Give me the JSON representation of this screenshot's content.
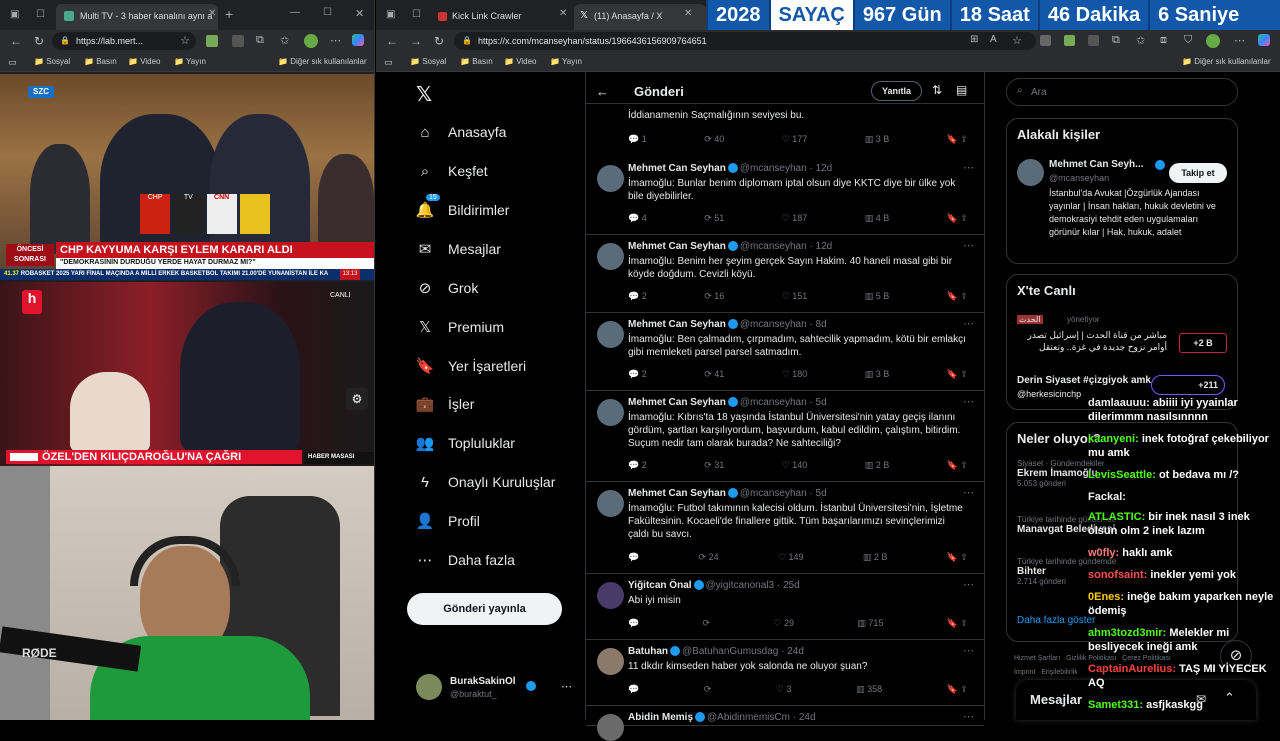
{
  "left_browser": {
    "tab_title": "Multi TV - 3 haber kanalını aynı a",
    "url": "https://lab.mert...",
    "bookmarks": [
      "Sosyal",
      "Basın",
      "Video",
      "Yayın",
      "Diğer sık kullanılanlar"
    ],
    "tv1": {
      "channel": "SZC",
      "corner_label": "ÖNCESİ SONRASI",
      "headline": "CHP KAYYUMA KARŞI EYLEM KARARI ALDI",
      "subline": "\"DEMOKRASİNİN DURDUĞU YERDE HAYAT DURMAZ MI?\"",
      "ticker": "ROBASKET 2025 YARI FİNAL MAÇINDA A MİLLİ ERKEK BASKETBOL TAKIMI 21.00'DE YUNANİSTAN İLE KA",
      "time": "13:13",
      "temp": "41.37",
      "mic_labels": [
        "CNN",
        "CHP",
        "TV"
      ]
    },
    "tv2": {
      "channel": "h",
      "live_label": "CANLI",
      "headline": "ÖZEL'DEN KILIÇDAROĞLU'NA ÇAĞRI",
      "sub_label": "HABER MASASI"
    },
    "cam": {
      "mic_brand": "RØDE"
    }
  },
  "right_browser": {
    "tabs": [
      {
        "title": "Kick Link Crawler"
      },
      {
        "title": "(11) Anasayfa / X"
      }
    ],
    "url": "https://x.com/mcanseyhan/status/1966436156909764651",
    "bookmarks": [
      "Sosyal",
      "Basın",
      "Video",
      "Yayın",
      "Diğer sık kullanılanlar"
    ]
  },
  "countdown": {
    "year": "2028",
    "label": "SAYAÇ",
    "days": "967 Gün",
    "hours": "18 Saat",
    "minutes": "46 Dakika",
    "seconds": "6 Saniye"
  },
  "x": {
    "nav": [
      {
        "label": "Anasayfa",
        "icon": "home-icon",
        "glyph": "⌂"
      },
      {
        "label": "Keşfet",
        "icon": "search-icon",
        "glyph": "⌕"
      },
      {
        "label": "Bildirimler",
        "icon": "bell-icon",
        "glyph": "🔔",
        "badge": "15"
      },
      {
        "label": "Mesajlar",
        "icon": "mail-icon",
        "glyph": "✉"
      },
      {
        "label": "Grok",
        "icon": "grok-icon",
        "glyph": "⊘"
      },
      {
        "label": "Premium",
        "icon": "x-icon",
        "glyph": "𝕏"
      },
      {
        "label": "Yer İşaretleri",
        "icon": "bookmark-icon",
        "glyph": "🔖"
      },
      {
        "label": "İşler",
        "icon": "briefcase-icon",
        "glyph": "💼"
      },
      {
        "label": "Topluluklar",
        "icon": "people-icon",
        "glyph": "👥"
      },
      {
        "label": "Onaylı Kuruluşlar",
        "icon": "lightning-icon",
        "glyph": "ϟ"
      },
      {
        "label": "Profil",
        "icon": "user-icon",
        "glyph": "👤"
      },
      {
        "label": "Daha fazla",
        "icon": "more-circle-icon",
        "glyph": "⋯"
      }
    ],
    "post_button": "Gönderi yayınla",
    "account": {
      "name": "BurakSakinOl",
      "handle": "@buraktut_"
    },
    "header": {
      "title": "Gönderi",
      "reply_button": "Yanıtla"
    },
    "search_placeholder": "Ara",
    "top_post": {
      "text_prev": "İddianamenin Saçmalığının seviyesi bu.",
      "replies": "1",
      "reposts": "40",
      "likes": "177",
      "views": "3 B"
    },
    "posts": [
      {
        "name": "Mehmet Can Seyhan",
        "handle": "@mcanseyhan · 12d",
        "text": "İmamoğlu: Bunlar benim diplomam iptal olsun diye KKTC diye bir ülke yok bile diyebilirler.",
        "replies": "4",
        "reposts": "51",
        "likes": "187",
        "views": "4 B"
      },
      {
        "name": "Mehmet Can Seyhan",
        "handle": "@mcanseyhan · 12d",
        "text": "İmamoğlu: Benim her şeyim gerçek Sayın Hakim. 40 haneli masal gibi bir köyde doğdum. Cevizli köyü.",
        "replies": "2",
        "reposts": "16",
        "likes": "151",
        "views": "5 B"
      },
      {
        "name": "Mehmet Can Seyhan",
        "handle": "@mcanseyhan · 8d",
        "text": "İmamoğlu: Ben çalmadım, çırpmadım, sahtecilik yapmadım, kötü bir emlakçı gibi memleketi parsel parsel satmadım.",
        "replies": "2",
        "reposts": "41",
        "likes": "180",
        "views": "3 B"
      },
      {
        "name": "Mehmet Can Seyhan",
        "handle": "@mcanseyhan · 5d",
        "text": "İmamoğlu: Kıbrıs'ta 18 yaşında İstanbul Üniversitesi'nin yatay geçiş ilanını gördüm, şartları karşılıyordum, başvurdum, kabul edildim, çalıştım, bitirdim. Suçum nedir tam olarak burada? Ne sahteciliği?",
        "replies": "2",
        "reposts": "31",
        "likes": "140",
        "views": "2 B"
      },
      {
        "name": "Mehmet Can Seyhan",
        "handle": "@mcanseyhan · 5d",
        "text": "İmamoğlu: Futbol takımının kalecisi oldum. İstanbul Üniversitesi'nin, İşletme Fakültesinin. Kocaeli'de finallere gittik. Tüm başarılarımızı sevinçlerimizi çaldı bu savcı.",
        "replies": "",
        "reposts": "24",
        "likes": "149",
        "views": "2 B"
      },
      {
        "name": "Yiğitcan Önal",
        "handle": "@yigitcanonal3 · 25d",
        "text": "Abi iyi misin",
        "replies": "",
        "reposts": "",
        "likes": "29",
        "views": "715"
      },
      {
        "name": "Batuhan",
        "handle": "@BatuhanGumusdag · 24d",
        "text": "11 dkdır kimseden haber yok salonda ne oluyor şuan?",
        "replies": "",
        "reposts": "",
        "likes": "3",
        "views": "358"
      },
      {
        "name": "Abidin Memiş",
        "handle": "@AbidinmemisCm · 24d",
        "text": "",
        "replies": "",
        "reposts": "",
        "likes": "",
        "views": ""
      }
    ],
    "related": {
      "title": "Alakalı kişiler",
      "name": "Mehmet Can Seyh...",
      "handle": "@mcanseyhan",
      "follow": "Takip et",
      "bio": "İstanbul'da Avukat |Özgürlük Ajandası yayınlar | İnsan hakları, hukuk devletini ve demokrasiyi tehdit eden uygulamaları görünür kılar | Hak, hukuk, adalet"
    },
    "live": {
      "title": "X'te Canlı",
      "host1": "الحدث",
      "host1_role": "yönetiyor",
      "item1": "مباشر من قناة الحدث | إسرائيل تصدر أوامر نزوح جديدة في غزة.. وتعتقل",
      "badge1": "+2 B",
      "item2": "Derin Siyaset #çizgiyok amk",
      "item2_sub": "@herkesicinchp",
      "badge2": "+211"
    },
    "trends": {
      "title": "Neler oluyor?",
      "items": [
        {
          "cat": "Siyaset · Gündemdekiler",
          "name": "Ekrem İmamoğlu",
          "count": "5.053 gönderi"
        },
        {
          "cat": "Türkiye tarihinde gündemde",
          "name": "Manavgat Belediyesi",
          "count": ""
        },
        {
          "cat": "Türkiye tarihinde gündemde",
          "name": "Bihter",
          "count": "2.714 gönderi"
        }
      ],
      "show_more": "Daha fazla göster"
    },
    "footer": [
      "Hizmet Şartları",
      "Gizlilik Politikası",
      "Çerez Politikası",
      "İmprint",
      "Erişilebilirlik"
    ],
    "messages": "Mesajlar"
  },
  "chat": [
    {
      "user": "damlaauuu:",
      "msg": "abiiii iyi yyainlar dilerimmm nasılsınnnn",
      "color": "#f0f0f0"
    },
    {
      "user": "kaanyeni:",
      "msg": "inek fotoğraf çekebiliyor mu amk",
      "color": "#53fc18"
    },
    {
      "user": "LevisSeattle:",
      "msg": "ot bedava mı /?",
      "color": "#53fc18"
    },
    {
      "user": "Fackal:",
      "msg": "",
      "color": "#f0f0f0"
    },
    {
      "user": "ATLASTIC:",
      "msg": "bir inek nasıl 3 inek olsun olm 2 inek lazım",
      "color": "#53fc18"
    },
    {
      "user": "w0fly:",
      "msg": "haklı amk",
      "color": "#ff7b7b"
    },
    {
      "user": "sonofsaint:",
      "msg": "inekler yemi yok",
      "color": "#ff5050"
    },
    {
      "user": "0Enes:",
      "msg": "ineğe bakım yaparken neyle ödemiş",
      "color": "#ffcc00"
    },
    {
      "user": "ahm3tozd3mir:",
      "msg": "Melekler mi besliyecek ineği amk",
      "color": "#53fc18"
    },
    {
      "user": "CaptainAurelius:",
      "msg": "TAŞ MI YİYECEK AQ",
      "color": "#ff4040"
    },
    {
      "user": "Samet331:",
      "msg": "asfjkaskgg",
      "color": "#53fc18"
    }
  ],
  "colors": {
    "accent": "#1d9bf0",
    "kick": "#53fc18",
    "countdown": "#1257a8"
  }
}
